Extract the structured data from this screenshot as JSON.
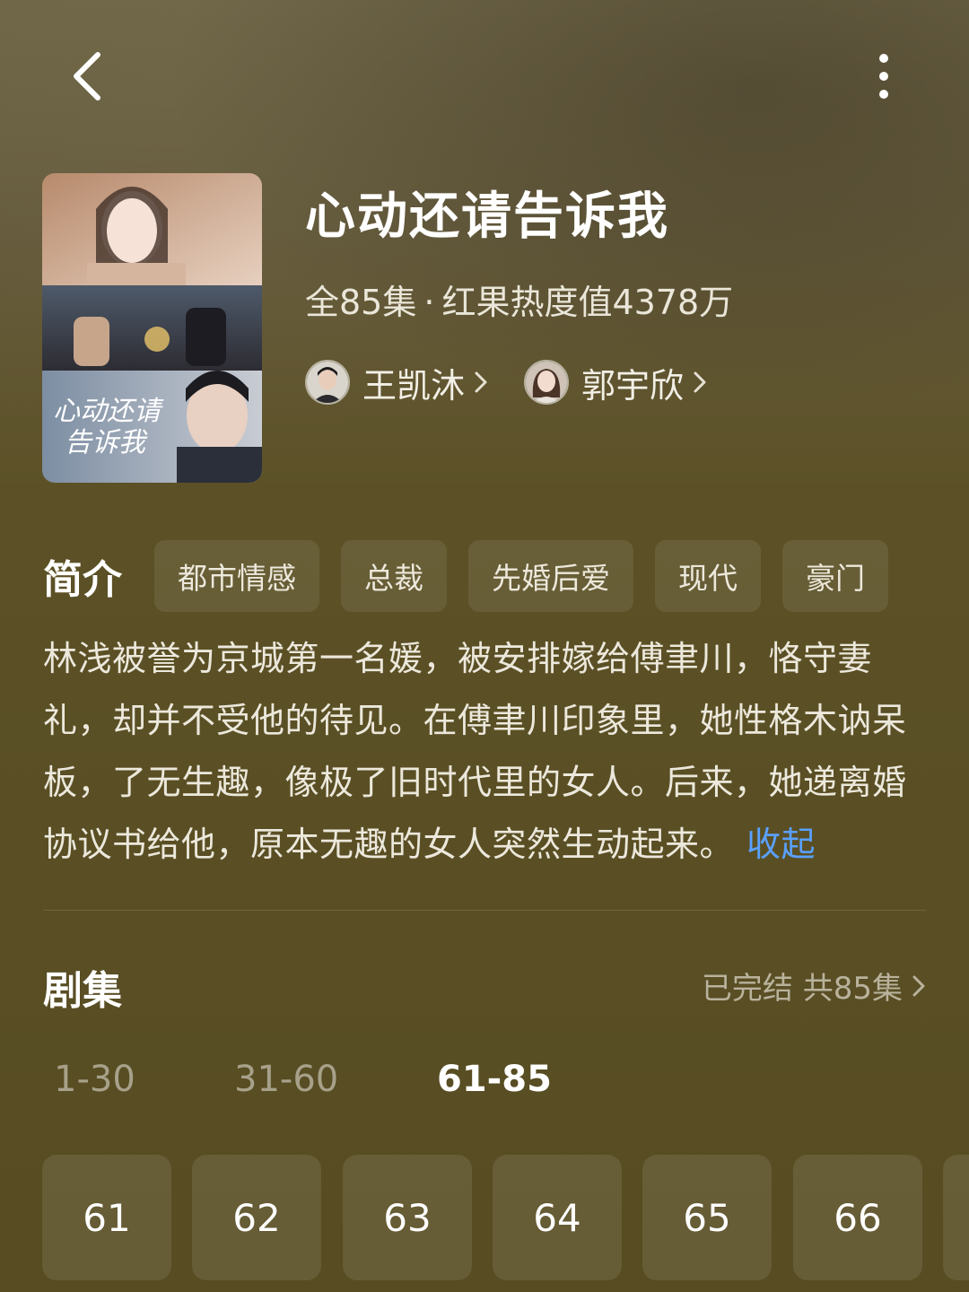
{
  "nav": {
    "back_icon": "chevron-left-icon",
    "more_icon": "more-vertical-icon"
  },
  "show": {
    "title": "心动还请告诉我",
    "episode_count": "全85集",
    "separator": "·",
    "heat": "红果热度值4378万",
    "poster_alt": "心动还请告诉我"
  },
  "actors": [
    {
      "name": "王凯沐"
    },
    {
      "name": "郭宇欣"
    }
  ],
  "intro": {
    "title": "简介",
    "tags": [
      "都市情感",
      "总裁",
      "先婚后爱",
      "现代",
      "豪门"
    ],
    "synopsis": "林浅被誉为京城第一名媛，被安排嫁给傅聿川，恪守妻礼，却并不受他的待见。在傅聿川印象里，她性格木讷呆板，了无生趣，像极了旧时代里的女人。后来，她递离婚协议书给他，原本无趣的女人突然生动起来。",
    "collapse_label": "收起"
  },
  "episodes": {
    "title": "剧集",
    "status": "已完结 共85集",
    "ranges": [
      "1-30",
      "31-60",
      "61-85"
    ],
    "active_range": 2,
    "items": [
      "61",
      "62",
      "63",
      "64",
      "65",
      "66"
    ]
  },
  "colors": {
    "accent_link": "#5aa0ff",
    "background": "#5c5126"
  }
}
